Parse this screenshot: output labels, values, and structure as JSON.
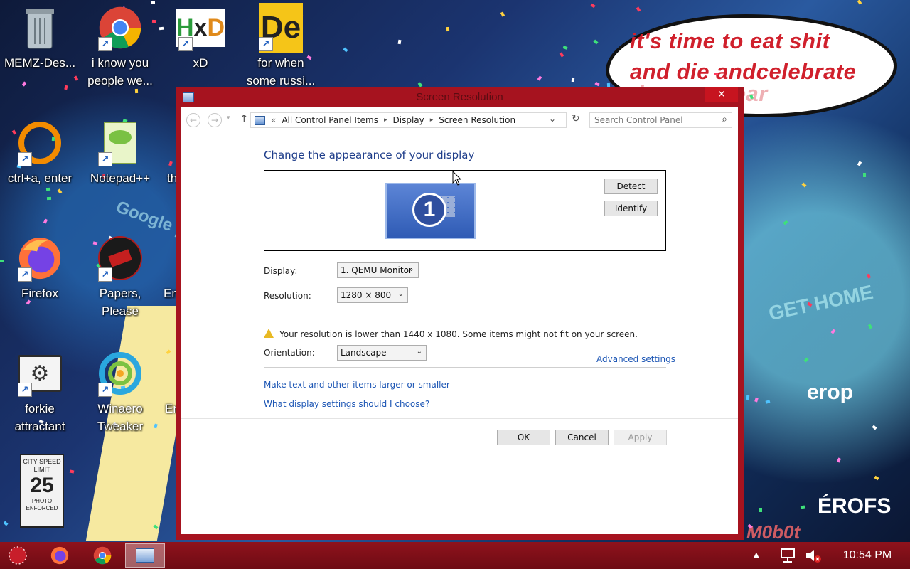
{
  "desktop": {
    "icons": [
      {
        "label": "MEMZ-Des...",
        "icon": "recycle-bin-icon"
      },
      {
        "label": "i know you people we...",
        "icon": "chrome-icon"
      },
      {
        "label": "xD",
        "icon": "hxd-icon"
      },
      {
        "label": "for when some russi...",
        "icon": "de-icon"
      },
      {
        "label": "ctrl+a, enter",
        "icon": "ring-icon"
      },
      {
        "label": "Notepad++",
        "icon": "notepadpp-icon"
      },
      {
        "label": "th",
        "icon": "image-icon"
      },
      {
        "label": "Firefox",
        "icon": "firefox-icon"
      },
      {
        "label": "Papers, Please",
        "icon": "papers-please-icon"
      },
      {
        "label": "En",
        "icon": "unknown-icon"
      },
      {
        "label": "forkie attractant",
        "icon": "settings-icon"
      },
      {
        "label": "Winaero Tweaker",
        "icon": "winaero-icon"
      },
      {
        "label": "En",
        "icon": "unknown-icon"
      }
    ],
    "wallpaper_text": {
      "line1": "it's time to eat shit",
      "line2": "and die andcelebrate",
      "line3": "the new year",
      "sign_google": "Google play",
      "sign_get_home": "GET HOME",
      "sign_erop": "erop",
      "sign_erofs": "ÉROFS",
      "watermark": "M0b0t",
      "speed_sign_top": "CITY SPEED LIMIT",
      "speed_sign_num": "25",
      "speed_sign_bottom": "PHOTO ENFORCED"
    }
  },
  "window": {
    "title": "Screen Resolution",
    "close_glyph": "✕",
    "address": {
      "back_glyph": "←",
      "forward_glyph": "→",
      "up_glyph": "↑",
      "prefix": "«",
      "crumbs": [
        "All Control Panel Items",
        "Display",
        "Screen Resolution"
      ],
      "separator": "▸",
      "refresh_glyph": "↻",
      "search_placeholder": "Search Control Panel",
      "search_glyph": "⌕"
    },
    "heading": "Change the appearance of your display",
    "monitor_number": "1",
    "detect_label": "Detect",
    "identify_label": "Identify",
    "display_label": "Display:",
    "display_value": "1. QEMU Monitor",
    "resolution_label": "Resolution:",
    "resolution_value": "1280 × 800",
    "warning_text": "Your resolution is lower than 1440 x 1080. Some items might not fit on your screen.",
    "orientation_label": "Orientation:",
    "orientation_value": "Landscape",
    "advanced_link": "Advanced settings",
    "link_text_size": "Make text and other items larger or smaller",
    "link_help": "What display settings should I choose?",
    "ok_label": "OK",
    "cancel_label": "Cancel",
    "apply_label": "Apply",
    "dropdown_arrow": "⌄"
  },
  "taskbar": {
    "clock": "10:54 PM",
    "tray_up": "▲",
    "colors": {
      "bar": "#8f121c",
      "window": "#a6131f"
    }
  }
}
